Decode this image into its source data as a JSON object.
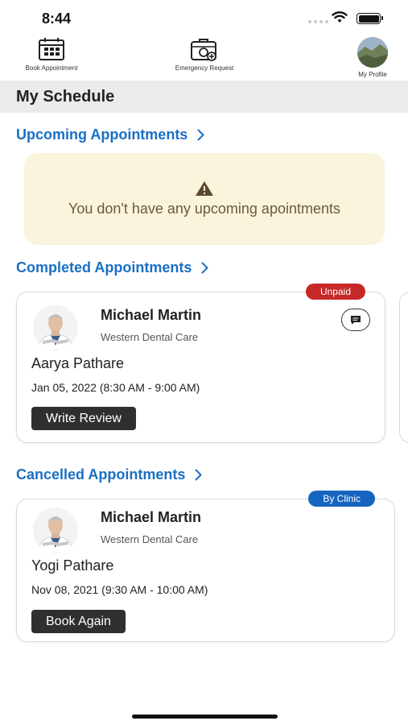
{
  "status_bar": {
    "time": "8:44"
  },
  "top_nav": {
    "book_label": "Book Appointment",
    "emergency_label": "Emergency Request",
    "profile_label": "My Profile"
  },
  "header": {
    "title": "My Schedule"
  },
  "upcoming": {
    "title": "Upcoming Appointments",
    "empty_message": "You don't have any upcoming apointments"
  },
  "completed": {
    "title": "Completed Appointments",
    "card": {
      "badge": "Unpaid",
      "doctor": "Michael Martin",
      "clinic": "Western Dental Care",
      "patient": "Aarya Pathare",
      "time": "Jan 05, 2022 (8:30 AM - 9:00 AM)",
      "action": "Write Review"
    }
  },
  "cancelled": {
    "title": "Cancelled Appointments",
    "card": {
      "badge": "By Clinic",
      "doctor": "Michael Martin",
      "clinic": "Western Dental Care",
      "patient": "Yogi Pathare",
      "time": "Nov 08, 2021 (9:30 AM - 10:00 AM)",
      "action": "Book Again"
    }
  },
  "colors": {
    "link_blue": "#1a6fc4",
    "unpaid_red": "#c62828",
    "clinic_blue": "#1565c0",
    "empty_bg": "#fbf4dd",
    "button_dark": "#2f2f2f"
  }
}
